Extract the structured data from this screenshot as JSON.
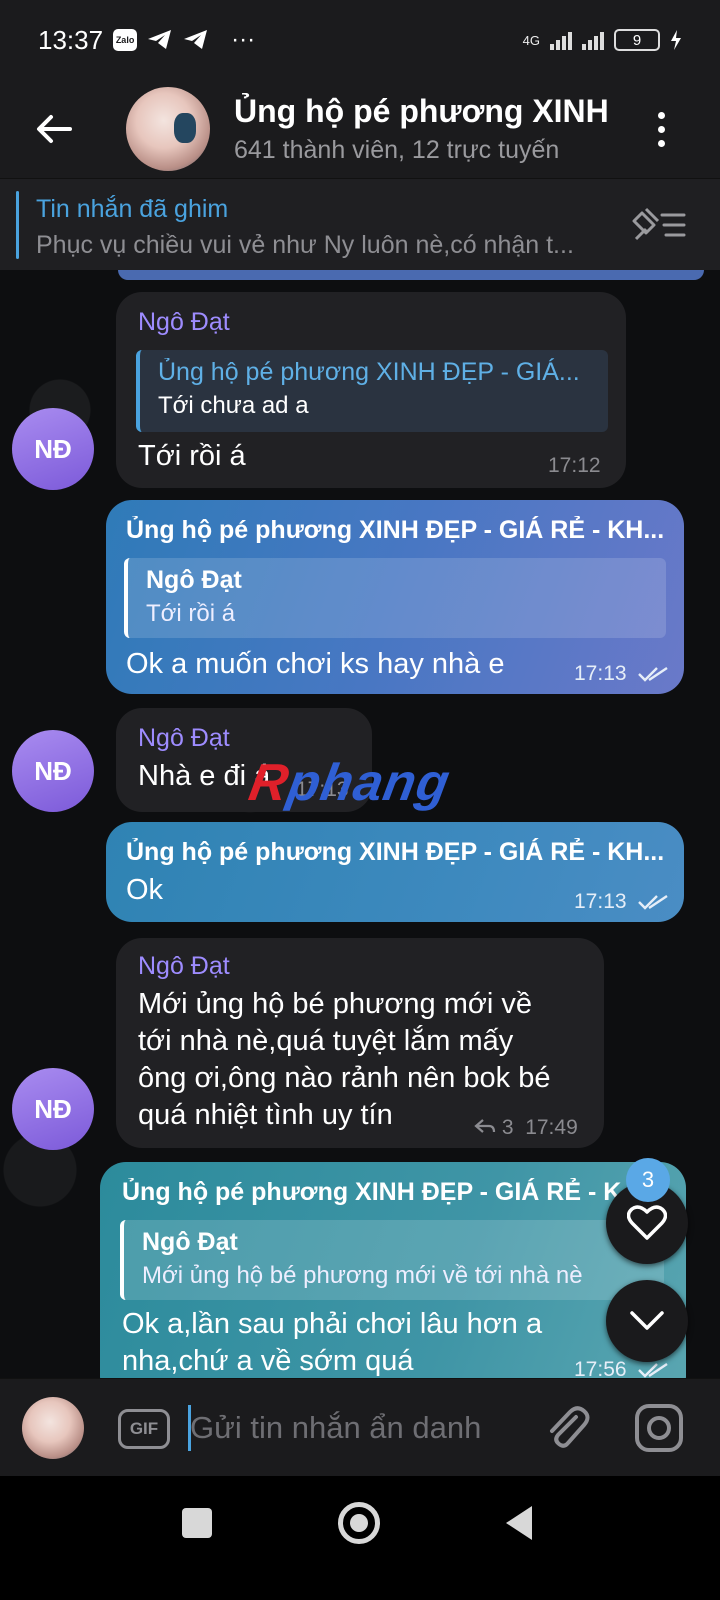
{
  "status_bar": {
    "time": "13:37",
    "app_icons": [
      "zalo-icon",
      "telegram-icon",
      "telegram-icon",
      "more-dots-icon"
    ],
    "zalo_label": "Zalo",
    "more": "···",
    "network": "4G",
    "battery": "9"
  },
  "header": {
    "title": "Ủng hộ pé phương XINH",
    "subtitle": "641 thành viên, 12 trực tuyến"
  },
  "pinned": {
    "title": "Tin nhắn đã ghim",
    "text": "Phục vụ chiều vui vẻ như Ny luôn nè,có nhận t..."
  },
  "messages": [
    {
      "direction": "in",
      "sender": "Ngô Đạt",
      "avatar": "NĐ",
      "reply": {
        "name": "Ủng hộ pé phương XINH ĐẸP - GIÁ...",
        "text": "Tới chưa ad a"
      },
      "text": "Tới rồi á",
      "time": "17:12"
    },
    {
      "direction": "out",
      "sender": "Ủng hộ pé phương XINH ĐẸP - GIÁ RẺ - KH...",
      "reply": {
        "name": "Ngô Đạt",
        "text": "Tới rồi á"
      },
      "text": "Ok a muốn chơi ks hay nhà e",
      "time": "17:13"
    },
    {
      "direction": "in",
      "sender": "Ngô Đạt",
      "avatar": "NĐ",
      "text": "Nhà e đi á",
      "time": "17:13"
    },
    {
      "direction": "out",
      "sender": "Ủng hộ pé phương XINH ĐẸP - GIÁ RẺ - KH...",
      "text": "Ok",
      "time": "17:13"
    },
    {
      "direction": "in",
      "sender": "Ngô Đạt",
      "avatar": "NĐ",
      "text_lines": [
        "Mới ủng hộ bé phương mới về",
        "tới nhà nè,quá tuyệt lắm mấy",
        "ông ơi,ông nào rảnh nên bok bé",
        "quá nhiệt tình uy tín"
      ],
      "reply_count": "3",
      "time": "17:49"
    },
    {
      "direction": "out",
      "sender": "Ủng hộ pé phương XINH ĐẸP - GIÁ RẺ - K",
      "reply": {
        "name": "Ngô Đạt",
        "text": "Mới ủng hộ bé phương mới về tới nhà nè"
      },
      "text_lines": [
        "Ok a,lần sau phải chơi lâu hơn a",
        "nha,chứ a về sớm quá"
      ],
      "time": "17:56"
    }
  ],
  "watermark": {
    "part1": "R",
    "part2": "phang"
  },
  "fab": {
    "reaction_badge": "3"
  },
  "input": {
    "gif_label": "GIF",
    "placeholder": "Gửi tin nhắn ẩn danh"
  }
}
